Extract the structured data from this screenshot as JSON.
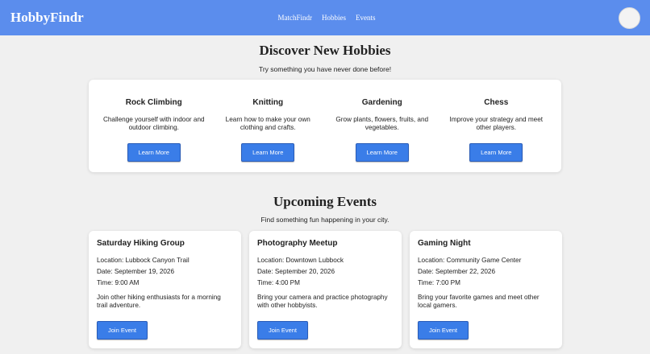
{
  "brand": "HobbyFindr",
  "nav": {
    "links": [
      "MatchFindr",
      "Hobbies",
      "Events"
    ]
  },
  "discover": {
    "title": "Discover New Hobbies",
    "subtitle": "Try something you have never done before!",
    "hobbies": [
      {
        "name": "Rock Climbing",
        "description": "Challenge yourself with indoor and outdoor climbing.",
        "button": "Learn More"
      },
      {
        "name": "Knitting",
        "description": "Learn how to make your own clothing and crafts.",
        "button": "Learn More"
      },
      {
        "name": "Gardening",
        "description": "Grow plants, flowers, fruits, and vegetables.",
        "button": "Learn More"
      },
      {
        "name": "Chess",
        "description": "Improve your strategy and meet other players.",
        "button": "Learn More"
      }
    ]
  },
  "events": {
    "title": "Upcoming Events",
    "subtitle": "Find something fun happening in your city.",
    "items": [
      {
        "name": "Saturday Hiking Group",
        "location": "Location: Lubbock Canyon Trail",
        "date": "Date: September 19, 2026",
        "time": "Time: 9:00 AM",
        "description": "Join other hiking enthusiasts for a morning trail adventure.",
        "button": "Join Event"
      },
      {
        "name": "Photography Meetup",
        "location": "Location: Downtown Lubbock",
        "date": "Date: September 20, 2026",
        "time": "Time: 4:00 PM",
        "description": "Bring your camera and practice photography with other hobbyists.",
        "button": "Join Event"
      },
      {
        "name": "Gaming Night",
        "location": "Location: Community Game Center",
        "date": "Date: September 22, 2026",
        "time": "Time: 7:00 PM",
        "description": "Bring your favorite games and meet other local gamers.",
        "button": "Join Event"
      }
    ]
  },
  "colors": {
    "navbar": "#5b8ded",
    "button": "#3a7de8",
    "background": "#f0f0f0"
  }
}
